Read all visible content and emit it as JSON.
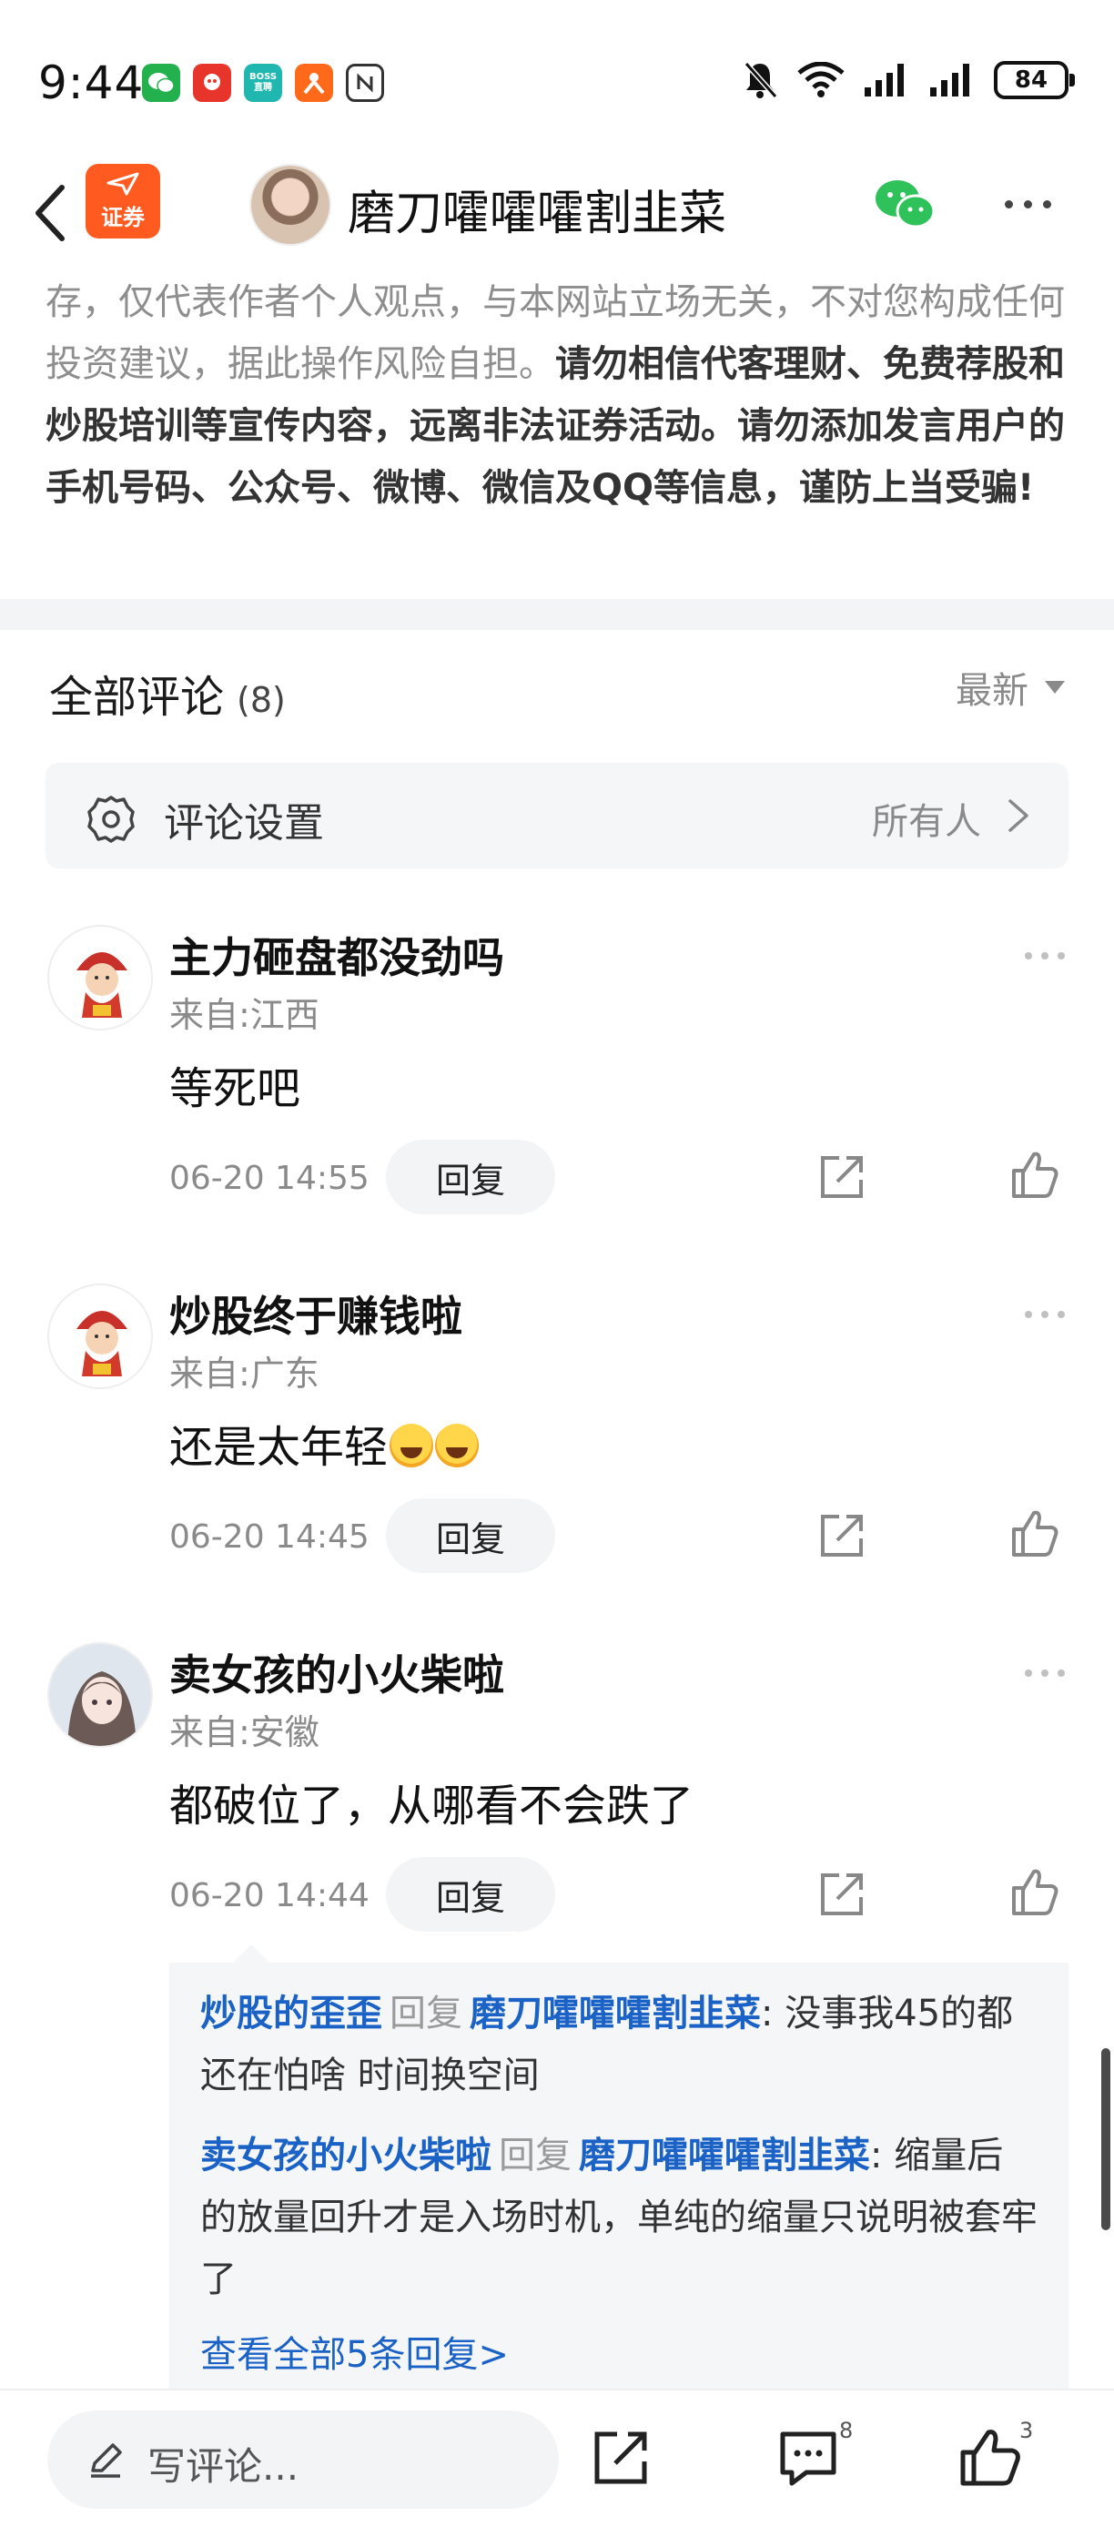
{
  "status_bar": {
    "time": "9:44",
    "battery": "84",
    "app_badges": [
      "BOSS",
      "直聘"
    ]
  },
  "nav": {
    "logo_text": "证券",
    "title": "磨刀嚯嚯嚯割韭菜"
  },
  "disclaimer": {
    "normal": "存，仅代表作者个人观点，与本网站立场无关，不对您构成任何投资建议，据此操作风险自担。",
    "emphasis": "请勿相信代客理财、免费荐股和炒股培训等宣传内容，远离非法证券活动。请勿添加发言用户的手机号码、公众号、微博、微信及QQ等信息，谨防上当受骗!"
  },
  "comments_header": {
    "title": "全部评论",
    "count": "(8)",
    "sort": "最新"
  },
  "settings": {
    "label": "评论设置",
    "value": "所有人"
  },
  "comments": [
    {
      "name": "主力砸盘都没劲吗",
      "location": "来自:江西",
      "text": "等死吧",
      "time": "06-20 14:55",
      "reply_label": "回复"
    },
    {
      "name": "炒股终于赚钱啦",
      "location": "来自:广东",
      "text": "还是太年轻",
      "time": "06-20 14:45",
      "reply_label": "回复"
    },
    {
      "name": "卖女孩的小火柴啦",
      "location": "来自:安徽",
      "text": "都破位了，从哪看不会跌了",
      "time": "06-20 14:44",
      "reply_label": "回复"
    }
  ],
  "replies": [
    {
      "from": "炒股的歪歪",
      "verb": "回复",
      "to": "磨刀嚯嚯嚯割韭菜",
      "text": ": 没事我45的都还在怕啥 时间换空间"
    },
    {
      "from": "卖女孩的小火柴啦",
      "verb": "回复",
      "to": "磨刀嚯嚯嚯割韭菜",
      "text": ": 缩量后的放量回升才是入场时机，单纯的缩量只说明被套牢了"
    }
  ],
  "view_all": "查看全部5条回复>",
  "bottom_bar": {
    "placeholder": "写评论...",
    "comment_count": "8",
    "like_count": "3"
  }
}
